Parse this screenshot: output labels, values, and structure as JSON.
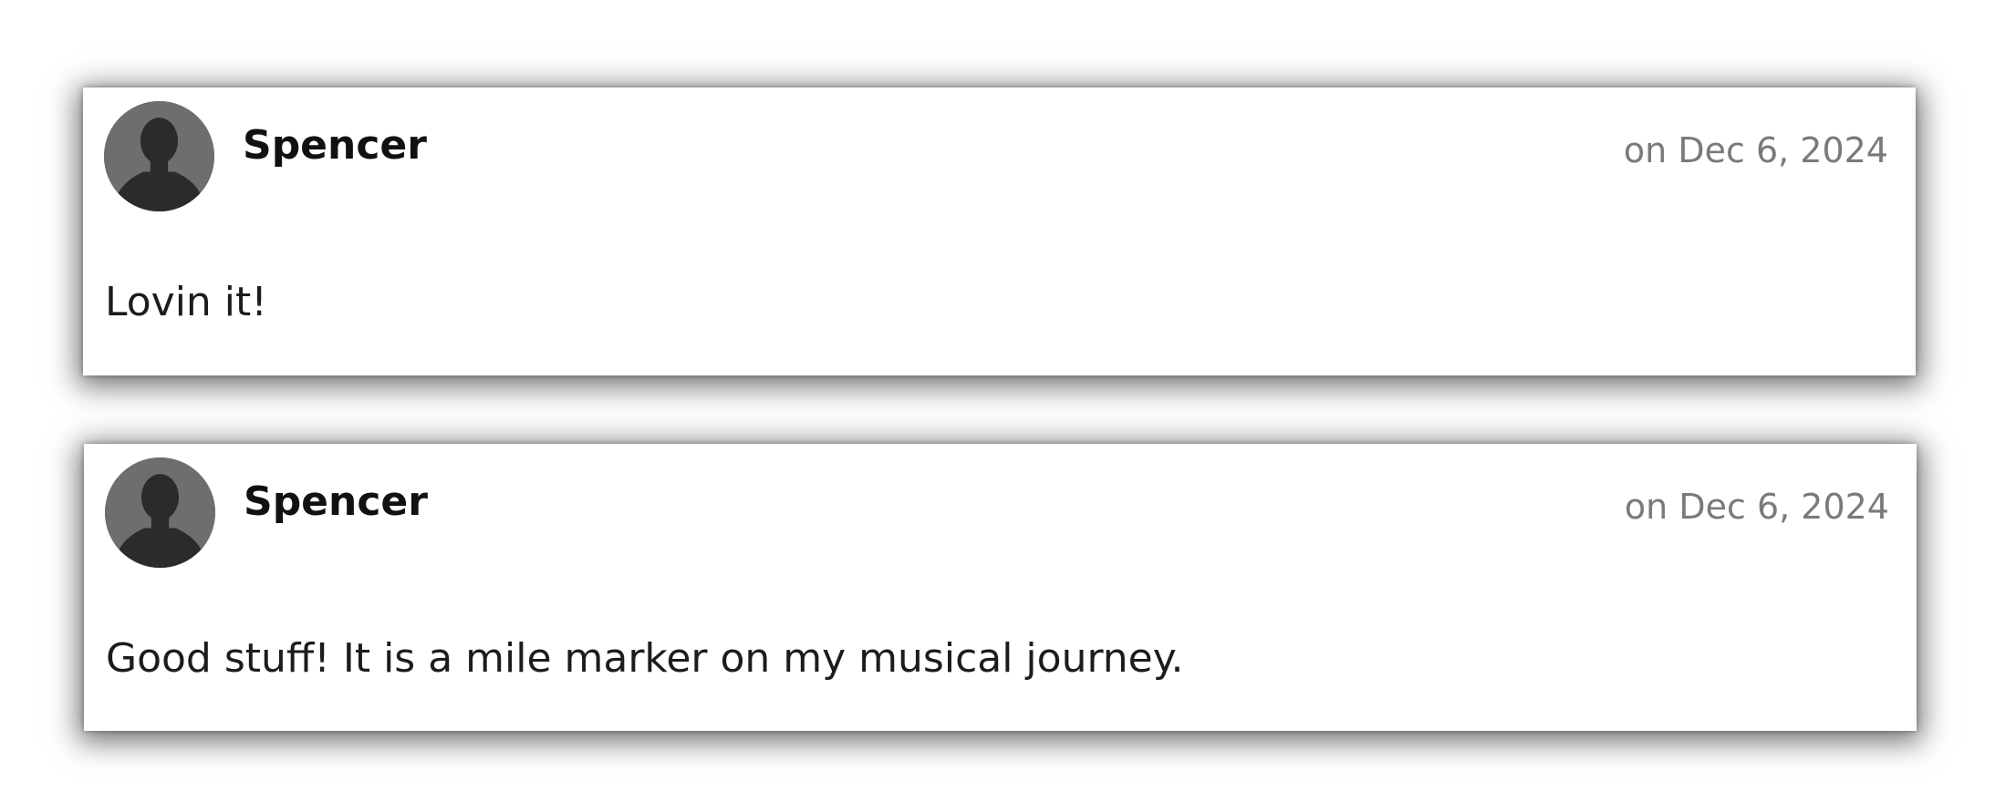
{
  "comments": [
    {
      "author": "Spencer",
      "date": "on Dec 6, 2024",
      "text": "Lovin it!",
      "avatar_icon": "user-silhouette-icon"
    },
    {
      "author": "Spencer",
      "date": "on Dec 6, 2024",
      "text": "Good stuff! It is a mile marker on my musical journey.",
      "avatar_icon": "user-silhouette-icon"
    }
  ],
  "colors": {
    "avatar_bg": "#6e6e6e",
    "avatar_fg": "#2b2b2b",
    "date_text": "#7a7a7a",
    "author_text": "#111111"
  }
}
